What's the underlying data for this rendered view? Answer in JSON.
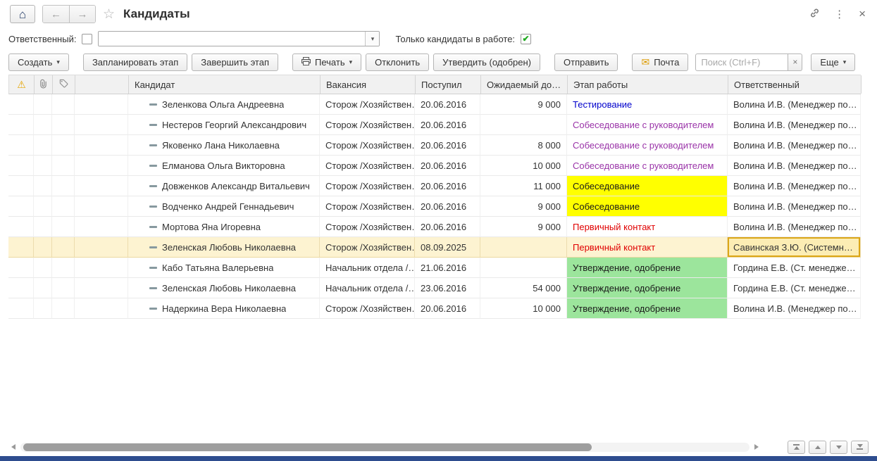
{
  "window": {
    "title": "Кандидаты"
  },
  "icons": {
    "home": "⌂",
    "back": "←",
    "forward": "→",
    "star": "☆",
    "kebab": "⋮",
    "close": "×",
    "caret_down": "▾",
    "check": "✔",
    "warning": "⚠",
    "mail": "✉",
    "clear": "×"
  },
  "filters": {
    "responsible_label": "Ответственный:",
    "responsible_checked": false,
    "responsible_value": "",
    "only_in_work_label": "Только кандидаты в работе:",
    "only_in_work_checked": true
  },
  "toolbar": {
    "create_label": "Создать",
    "plan_stage_label": "Запланировать этап",
    "finish_stage_label": "Завершить этап",
    "print_label": "Печать",
    "decline_label": "Отклонить",
    "approve_label": "Утвердить (одобрен)",
    "send_label": "Отправить",
    "mail_label": "Почта",
    "search_placeholder": "Поиск (Ctrl+F)",
    "more_label": "Еще"
  },
  "table": {
    "headers": {
      "candidate": "Кандидат",
      "vacancy": "Вакансия",
      "received": "Поступил",
      "expected_income": "Ожидаемый до…",
      "stage": "Этап работы",
      "responsible": "Ответственный"
    },
    "rows": [
      {
        "candidate": "Зеленкова Ольга Андреевна",
        "vacancy": "Сторож /Хозяйствен…",
        "received": "20.06.2016",
        "expected": "9 000",
        "stage": "Тестирование",
        "stage_style": "blue",
        "responsible": "Волина И.В. (Менеджер по…",
        "selected": false
      },
      {
        "candidate": "Нестеров Георгий Александрович",
        "vacancy": "Сторож /Хозяйствен…",
        "received": "20.06.2016",
        "expected": "",
        "stage": "Собеседование с руководителем",
        "stage_style": "purple",
        "responsible": "Волина И.В. (Менеджер по…",
        "selected": false
      },
      {
        "candidate": "Яковенко Лана Николаевна",
        "vacancy": "Сторож /Хозяйствен…",
        "received": "20.06.2016",
        "expected": "8 000",
        "stage": "Собеседование с руководителем",
        "stage_style": "purple",
        "responsible": "Волина И.В. (Менеджер по…",
        "selected": false
      },
      {
        "candidate": "Елманова Ольга Викторовна",
        "vacancy": "Сторож /Хозяйствен…",
        "received": "20.06.2016",
        "expected": "10 000",
        "stage": "Собеседование с руководителем",
        "stage_style": "purple",
        "responsible": "Волина И.В. (Менеджер по…",
        "selected": false
      },
      {
        "candidate": "Довженков Александр Витальевич",
        "vacancy": "Сторож /Хозяйствен…",
        "received": "20.06.2016",
        "expected": "11 000",
        "stage": "Собеседование",
        "stage_style": "yellow",
        "responsible": "Волина И.В. (Менеджер по…",
        "selected": false
      },
      {
        "candidate": "Водченко Андрей Геннадьевич",
        "vacancy": "Сторож /Хозяйствен…",
        "received": "20.06.2016",
        "expected": "9 000",
        "stage": "Собеседование",
        "stage_style": "yellow",
        "responsible": "Волина И.В. (Менеджер по…",
        "selected": false
      },
      {
        "candidate": "Мортова Яна Игоревна",
        "vacancy": "Сторож /Хозяйствен…",
        "received": "20.06.2016",
        "expected": "9 000",
        "stage": "Первичный контакт",
        "stage_style": "red",
        "responsible": "Волина И.В. (Менеджер по…",
        "selected": false
      },
      {
        "candidate": "Зеленская Любовь Николаевна",
        "vacancy": "Сторож /Хозяйствен…",
        "received": "08.09.2025",
        "expected": "",
        "stage": "Первичный контакт",
        "stage_style": "red",
        "responsible": "Савинская З.Ю. (Системн…",
        "selected": true
      },
      {
        "candidate": "Кабо Татьяна Валерьевна",
        "vacancy": "Начальник отдела /…",
        "received": "21.06.2016",
        "expected": "",
        "stage": "Утверждение, одобрение",
        "stage_style": "green",
        "responsible": "Гордина Е.В. (Ст. менедже…",
        "selected": false
      },
      {
        "candidate": "Зеленская Любовь Николаевна",
        "vacancy": "Начальник отдела /…",
        "received": "23.06.2016",
        "expected": "54 000",
        "stage": "Утверждение, одобрение",
        "stage_style": "green",
        "responsible": "Гордина Е.В. (Ст. менедже…",
        "selected": false
      },
      {
        "candidate": "Надеркина Вера Николаевна",
        "vacancy": "Сторож /Хозяйствен…",
        "received": "20.06.2016",
        "expected": "10 000",
        "stage": "Утверждение, одобрение",
        "stage_style": "green",
        "responsible": "Волина И.В. (Менеджер по…",
        "selected": false
      }
    ]
  },
  "colors": {
    "stage_blue": "#0000cc",
    "stage_purple": "#9a33a8",
    "stage_red": "#e00000",
    "stage_yellow_bg": "#ffff00",
    "stage_green_bg": "#9ce59c",
    "selected_row_bg": "#fdf3d1",
    "focus_border": "#dba617",
    "accent_bottom_bar": "#2e4d8f"
  }
}
